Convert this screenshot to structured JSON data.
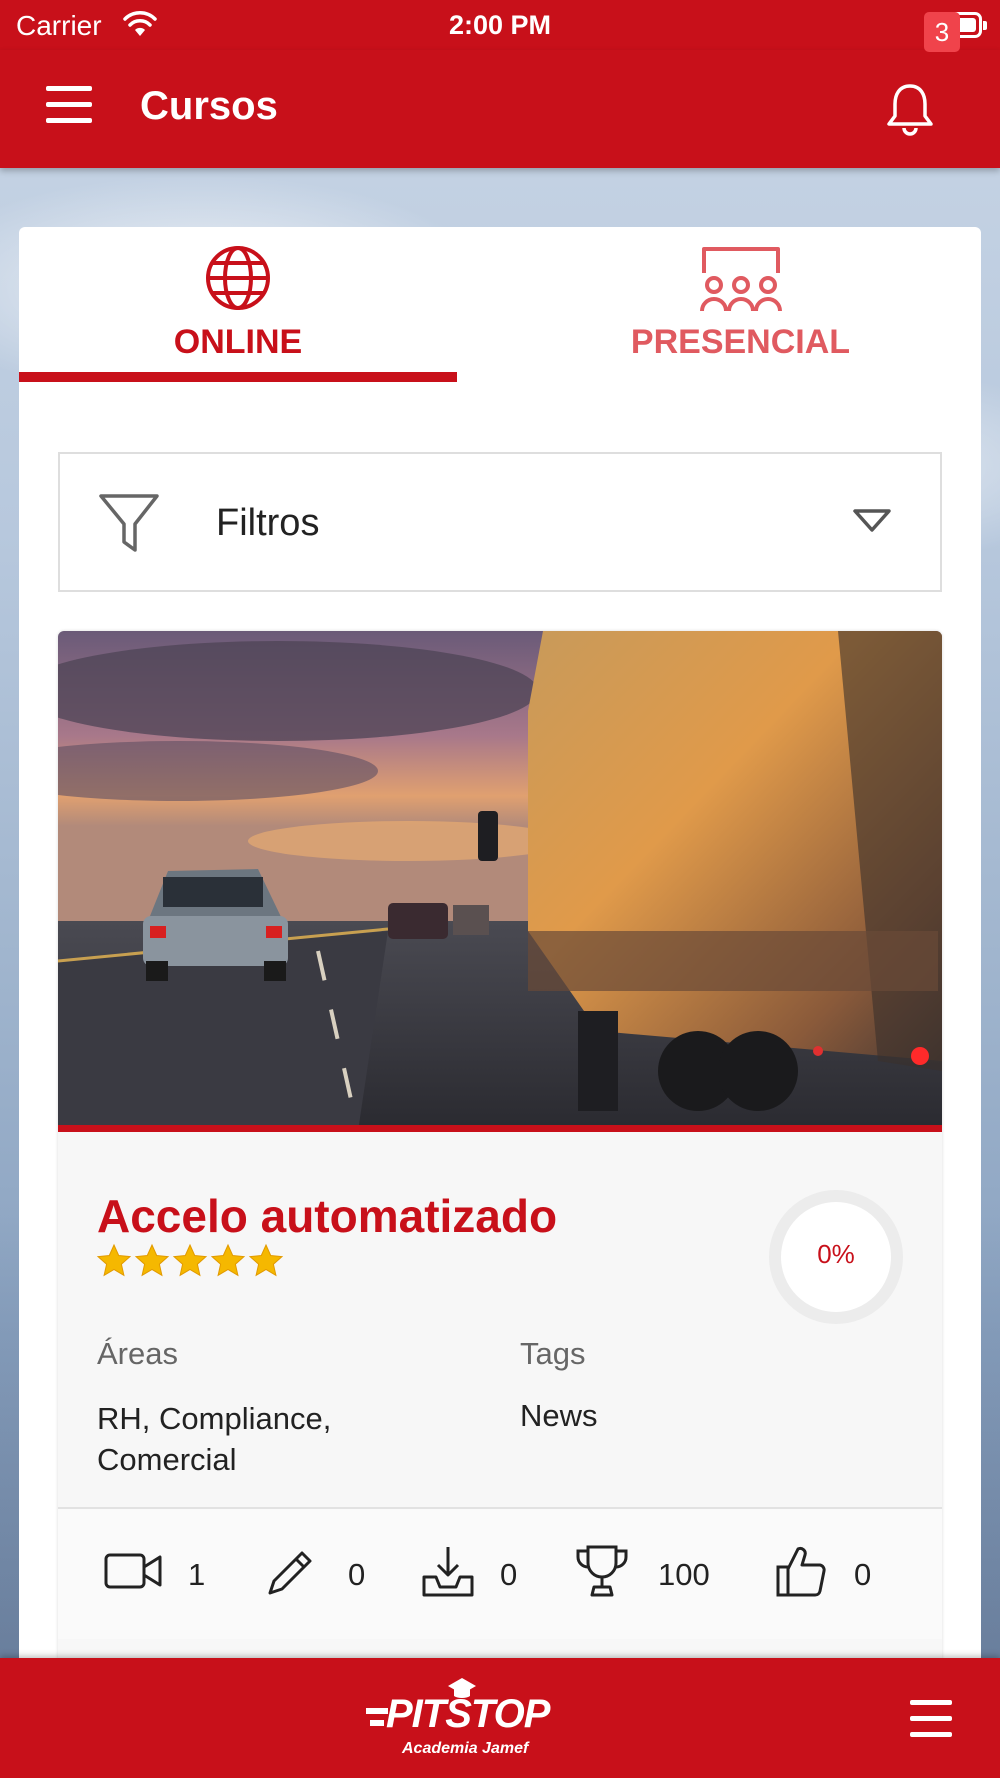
{
  "status_bar": {
    "carrier": "Carrier",
    "time": "2:00 PM"
  },
  "header": {
    "title": "Cursos",
    "notification_count": "3"
  },
  "tabs": [
    {
      "label": "ONLINE",
      "icon": "globe-icon",
      "active": true
    },
    {
      "label": "PRESENCIAL",
      "icon": "classroom-icon",
      "active": false
    }
  ],
  "filter": {
    "label": "Filtros",
    "icon": "funnel-icon"
  },
  "course": {
    "title": "Accelo automatizado",
    "rating": 5,
    "rating_max": 5,
    "progress_text": "0%",
    "progress": 0,
    "areas_label": "Áreas",
    "areas_value": "RH, Compliance, Comercial",
    "tags_label": "Tags",
    "tags_value": "News",
    "stats": [
      {
        "icon": "video-icon",
        "value": "1"
      },
      {
        "icon": "pencil-icon",
        "value": "0"
      },
      {
        "icon": "download-icon",
        "value": "0"
      },
      {
        "icon": "trophy-icon",
        "value": "100"
      },
      {
        "icon": "thumbs-up-icon",
        "value": "0"
      }
    ]
  },
  "bottom_bar": {
    "logo_text": "PITSTOP",
    "logo_subtitle": "Academia Jamef"
  },
  "colors": {
    "brand_red": "#c8101a",
    "badge_red": "#f0434b",
    "star_yellow": "#f5b800"
  }
}
